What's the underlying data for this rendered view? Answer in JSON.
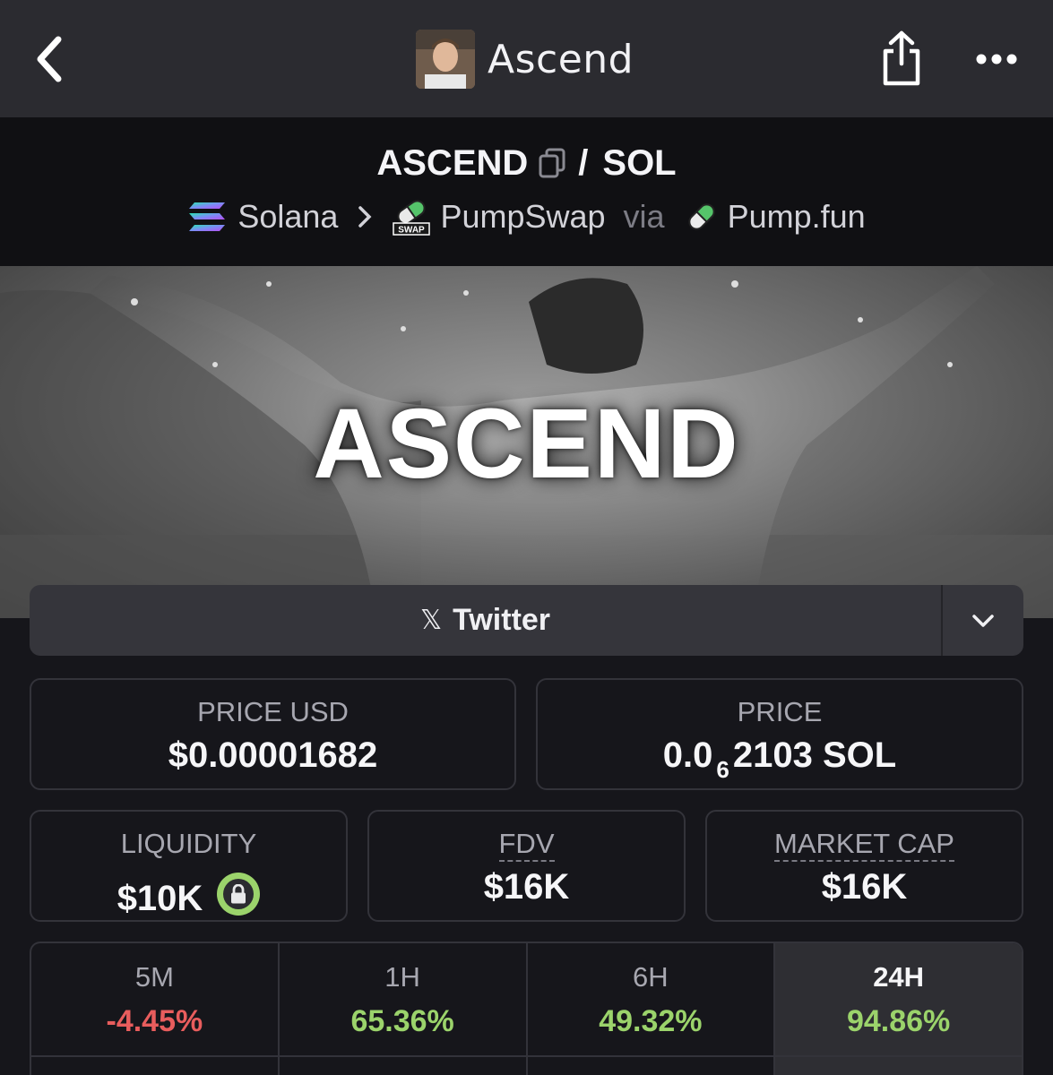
{
  "header": {
    "title": "Ascend",
    "icons": {
      "back": "chevron-left-icon",
      "share": "share-icon",
      "more": "more-dots-icon"
    }
  },
  "pair": {
    "base": "ASCEND",
    "separator": "/",
    "quote": "SOL",
    "chain": "Solana",
    "dex": "PumpSwap",
    "dex_badge": "SWAP",
    "via": "via",
    "launchpad": "Pump.fun"
  },
  "banner": {
    "headline": "ASCEND"
  },
  "social": {
    "label": "Twitter"
  },
  "stats": {
    "price_usd": {
      "label": "PRICE USD",
      "value": "$0.00001682"
    },
    "price_native": {
      "label": "PRICE",
      "prefix": "0.0",
      "zeros": "6",
      "digits": "2103",
      "unit": "SOL"
    },
    "liquidity": {
      "label": "LIQUIDITY",
      "value": "$10K"
    },
    "fdv": {
      "label": "FDV",
      "value": "$16K"
    },
    "market_cap": {
      "label": "MARKET CAP",
      "value": "$16K"
    }
  },
  "timeframes": [
    {
      "label": "5M",
      "change": "-4.45%",
      "color": "#e85d5d"
    },
    {
      "label": "1H",
      "change": "65.36%",
      "color": "#9bd36b"
    },
    {
      "label": "6H",
      "change": "49.32%",
      "color": "#9bd36b"
    },
    {
      "label": "24H",
      "change": "94.86%",
      "color": "#9bd36b",
      "active": true
    }
  ],
  "colors": {
    "positive": "#9bd36b",
    "negative": "#e85d5d",
    "nav_bg": "#2b2b30",
    "page_bg": "#16161b"
  }
}
